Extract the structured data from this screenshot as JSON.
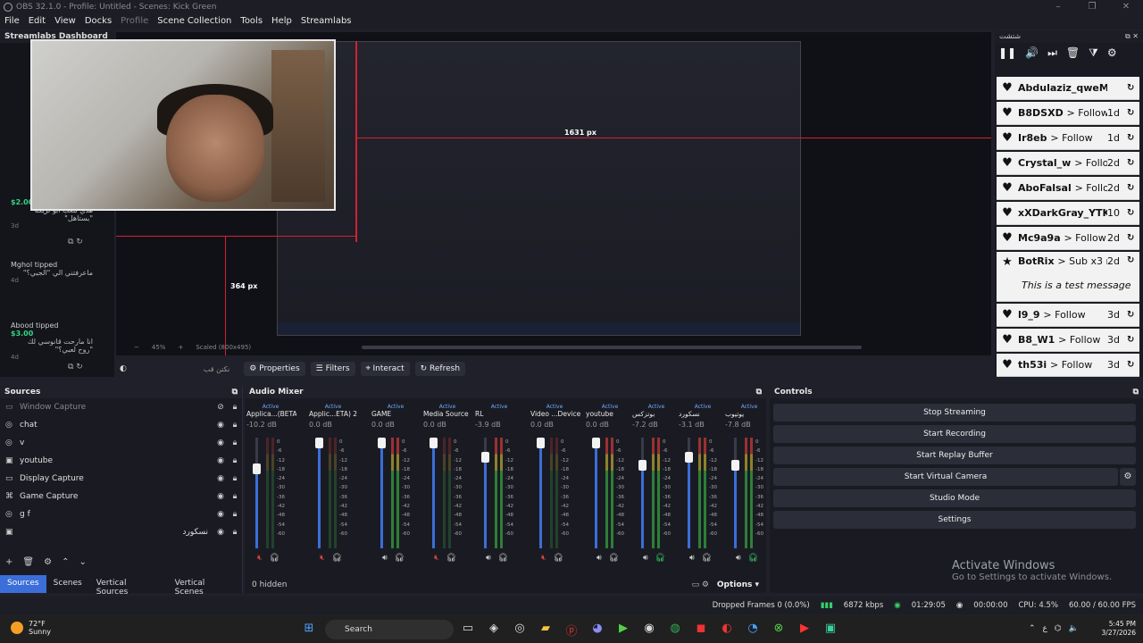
{
  "window": {
    "title": "OBS 32.1.0 - Profile: Untitled - Scenes: Kick Green",
    "controls": [
      "–",
      "❐",
      "✕"
    ]
  },
  "menu": [
    "File",
    "Edit",
    "View",
    "Docks",
    "Profile",
    "Scene Collection",
    "Tools",
    "Help",
    "Streamlabs"
  ],
  "preview": {
    "label_width": "1631 px",
    "label_height": "364 px",
    "label_height_small": "364 px",
    "zoom": "45%",
    "scale_mode": "Scaled (800x495)"
  },
  "streamlabs": {
    "title": "Streamlabs Dashboard",
    "tips": [
      {
        "amount": "$2.00",
        "message": "هذي للعب أبو تريكه \"بستاهل\"",
        "time": "3d"
      },
      {
        "who": "Mghol tipped",
        "message": "ماعرفتني الي \"الجبي؟\"",
        "time": "4d"
      },
      {
        "who": "Abood tipped",
        "amount": "$3.00",
        "message": "انا مارحت قانوسي لك \"روح لعبي؟\"",
        "time": "4d"
      }
    ]
  },
  "chat": {
    "title": "شتشت",
    "events": [
      {
        "user": "Abdulaziz_qweM",
        "action": "> Follow",
        "ago": ""
      },
      {
        "user": "B8DSXD",
        "action": "> Follow",
        "ago": "1d"
      },
      {
        "user": "Ir8eb",
        "action": "> Follow",
        "ago": "1d"
      },
      {
        "user": "Crystal_w",
        "action": "> Follow",
        "ago": "2d"
      },
      {
        "user": "AboFalsal",
        "action": "> Follow",
        "ago": "2d"
      },
      {
        "user": "xXDarkGray_YTK",
        "action": "",
        "ago": "10"
      },
      {
        "user": "Mc9a9a",
        "action": "> Follow",
        "ago": "2d"
      },
      {
        "user": "BotRix",
        "action": "> Sub x3 months",
        "ago": "2d",
        "sub": "This is a test message"
      },
      {
        "user": "l9_9",
        "action": "> Follow",
        "ago": "3d"
      },
      {
        "user": "B8_W1",
        "action": "> Follow",
        "ago": "3d"
      },
      {
        "user": "th53i",
        "action": "> Follow",
        "ago": "3d"
      }
    ]
  },
  "context_bar": {
    "no_source": "نكتن قب",
    "properties": "Properties",
    "filters": "Filters",
    "interact": "Interact",
    "refresh": "Refresh"
  },
  "sources": {
    "title": "Sources",
    "items": [
      {
        "name": "Window Capture",
        "icon": "window-icon",
        "hidden": true
      },
      {
        "name": "chat",
        "icon": "globe-icon"
      },
      {
        "name": "v",
        "icon": "globe-icon"
      },
      {
        "name": "youtube",
        "icon": "image-icon"
      },
      {
        "name": "Display Capture",
        "icon": "monitor-icon"
      },
      {
        "name": "Game Capture",
        "icon": "gamepad-icon"
      },
      {
        "name": "g f",
        "icon": "globe-icon"
      },
      {
        "name": "نسكورد",
        "icon": "image-icon"
      }
    ]
  },
  "tabs": [
    "Sources",
    "Scenes",
    "Vertical Sources",
    "Vertical Scenes"
  ],
  "mixer": {
    "title": "Audio Mixer",
    "hidden_label": "0 hidden",
    "options_label": "Options",
    "active_label": "Active",
    "scale": [
      "0",
      "-6",
      "-12",
      "-18",
      "-24",
      "-30",
      "-36",
      "-42",
      "-48",
      "-54",
      "-60"
    ],
    "channels": [
      {
        "name": "Applica...(BETA)",
        "db": "-10.2 dB",
        "level": 0.74,
        "muted": true
      },
      {
        "name": "Applic...ETA) 2",
        "db": "0.0 dB",
        "level": 1.0,
        "muted": true
      },
      {
        "name": "GAME",
        "db": "0.0 dB",
        "level": 1.0,
        "muted": false
      },
      {
        "name": "Media Source",
        "db": "0.0 dB",
        "level": 1.0,
        "muted": true
      },
      {
        "name": "RL",
        "db": "-3.9 dB",
        "level": 0.86,
        "muted": false
      },
      {
        "name": "Video ...Device",
        "db": "0.0 dB",
        "level": 1.0,
        "muted": true
      },
      {
        "name": "youtube",
        "db": "0.0 dB",
        "level": 1.0,
        "muted": false
      },
      {
        "name": "بوتزكس",
        "db": "-7.2 dB",
        "level": 0.78,
        "muted": false
      },
      {
        "name": "نسكورد",
        "db": "-3.1 dB",
        "level": 0.86,
        "muted": false
      },
      {
        "name": "يوتيوب",
        "db": "-7.8 dB",
        "level": 0.78,
        "muted": false
      }
    ]
  },
  "controls": {
    "title": "Controls",
    "buttons": [
      "Stop Streaming",
      "Start Recording",
      "Start Replay Buffer",
      "Start Virtual Camera",
      "Studio Mode",
      "Settings"
    ],
    "watermark_1": "Activate Windows",
    "watermark_2": "Go to Settings to activate Windows."
  },
  "status": {
    "dropped": "Dropped Frames 0 (0.0%)",
    "bitrate": "6872 kbps",
    "stream_time": "01:29:05",
    "rec_time": "00:00:00",
    "cpu": "CPU: 4.5%",
    "fps": "60.00 / 60.00 FPS"
  },
  "taskbar": {
    "temp": "72°F",
    "weather": "Sunny",
    "search": "Search",
    "time": "5:45 PM",
    "date": "3/27/2026",
    "lang": "ع"
  },
  "colors": {
    "accent": "#3b6ed8",
    "status_green": "#39d06b",
    "red_guide": "#d42030"
  }
}
